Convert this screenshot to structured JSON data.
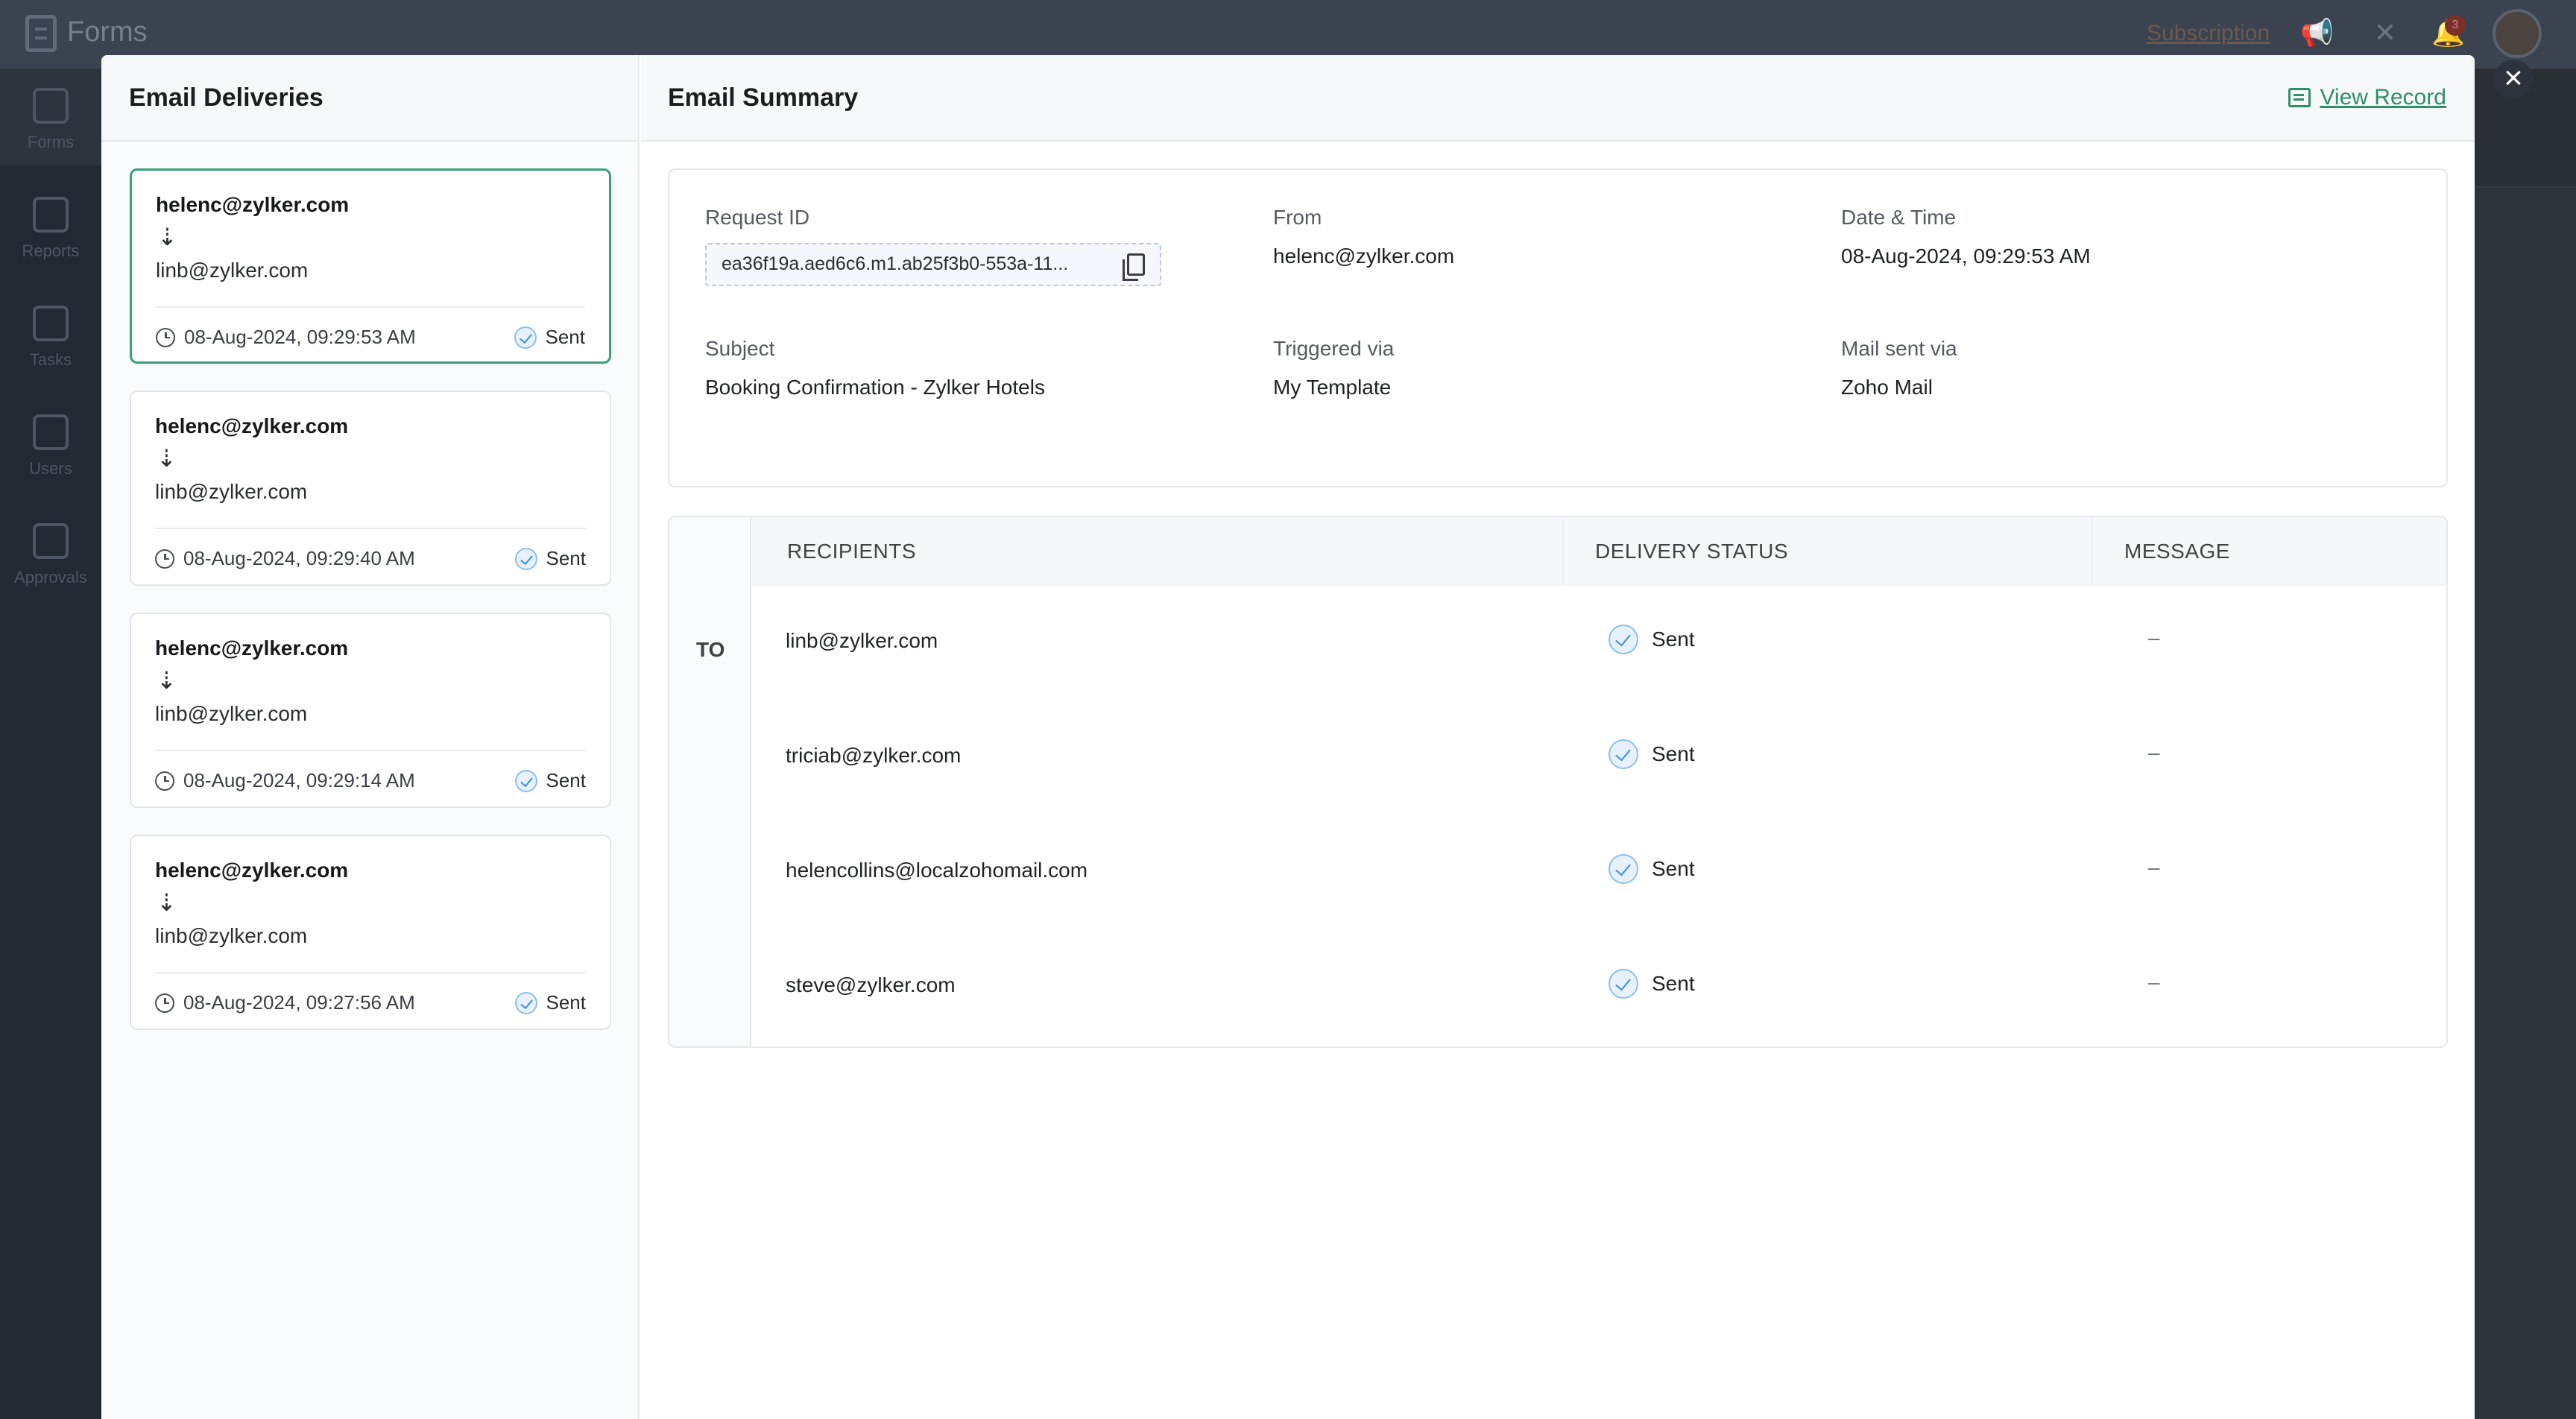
{
  "app": {
    "name": "Forms",
    "subscription_link": "Subscription",
    "notification_count": "3",
    "sidebar": [
      {
        "label": "Forms",
        "icon": "forms-icon"
      },
      {
        "label": "Reports",
        "icon": "reports-icon"
      },
      {
        "label": "Tasks",
        "icon": "tasks-icon"
      },
      {
        "label": "Users",
        "icon": "users-icon"
      },
      {
        "label": "Approvals",
        "icon": "approvals-icon"
      }
    ]
  },
  "deliveries": {
    "title": "Email Deliveries",
    "items": [
      {
        "from": "helenc@zylker.com",
        "arrow": "⇣",
        "to": "linb@zylker.com",
        "time": "08-Aug-2024, 09:29:53 AM",
        "status": "Sent"
      },
      {
        "from": "helenc@zylker.com",
        "arrow": "⇣",
        "to": "linb@zylker.com",
        "time": "08-Aug-2024, 09:29:40 AM",
        "status": "Sent"
      },
      {
        "from": "helenc@zylker.com",
        "arrow": "⇣",
        "to": "linb@zylker.com",
        "time": "08-Aug-2024, 09:29:14 AM",
        "status": "Sent"
      },
      {
        "from": "helenc@zylker.com",
        "arrow": "⇣",
        "to": "linb@zylker.com",
        "time": "08-Aug-2024, 09:27:56 AM",
        "status": "Sent"
      }
    ]
  },
  "summary": {
    "title": "Email Summary",
    "view_record": "View Record",
    "request_id_label": "Request ID",
    "request_id": "ea36f19a.aed6c6.m1.ab25f3b0-553a-11...",
    "from_label": "From",
    "from": "helenc@zylker.com",
    "datetime_label": "Date & Time",
    "datetime": "08-Aug-2024, 09:29:53 AM",
    "subject_label": "Subject",
    "subject": "Booking Confirmation - Zylker Hotels",
    "triggered_label": "Triggered via",
    "triggered": "My Template",
    "mailvia_label": "Mail sent via",
    "mailvia": "Zoho Mail"
  },
  "recipients": {
    "to_label": "TO",
    "headers": [
      "RECIPIENTS",
      "DELIVERY STATUS",
      "MESSAGE"
    ],
    "rows": [
      {
        "email": "linb@zylker.com",
        "status": "Sent",
        "message": "–"
      },
      {
        "email": "triciab@zylker.com",
        "status": "Sent",
        "message": "–"
      },
      {
        "email": "helencollins@localzohomail.com",
        "status": "Sent",
        "message": "–"
      },
      {
        "email": "steve@zylker.com",
        "status": "Sent",
        "message": "–"
      }
    ]
  },
  "colors": {
    "accent": "#3aa079",
    "link": "#2e8f68",
    "sent_check": "#3b8fd9"
  }
}
